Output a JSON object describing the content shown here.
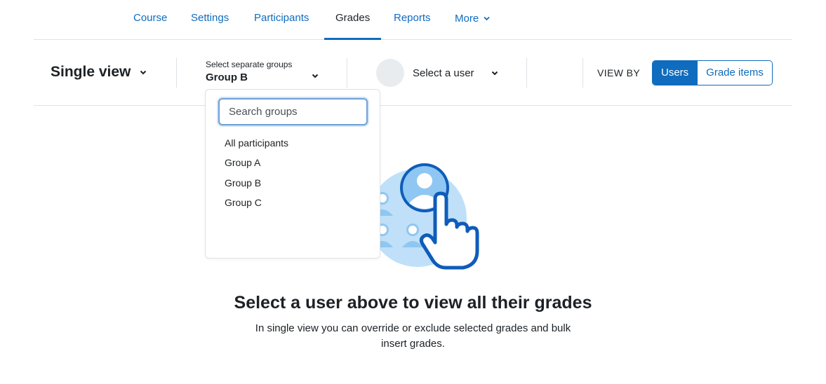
{
  "nav": {
    "tabs": [
      {
        "label": "Course"
      },
      {
        "label": "Settings"
      },
      {
        "label": "Participants"
      },
      {
        "label": "Grades"
      },
      {
        "label": "Reports"
      },
      {
        "label": "More"
      }
    ],
    "active_tab": "Grades"
  },
  "tertiary": {
    "view_selector": "Single view",
    "group_select": {
      "label": "Select separate groups",
      "value": "Group B"
    },
    "user_select": "Select a user",
    "view_by": "VIEW BY",
    "view_buttons": [
      {
        "label": "Users",
        "active": true
      },
      {
        "label": "Grade items",
        "active": false
      }
    ]
  },
  "group_dropdown": {
    "search_placeholder": "Search groups",
    "search_value": "",
    "options": [
      "All participants",
      "Group A",
      "Group B",
      "Group C"
    ]
  },
  "empty_state": {
    "title": "Select a user above to view all their grades",
    "description": "In single view you can override or exclude selected grades and bulk insert grades."
  },
  "colors": {
    "accent": "#0f6cbf",
    "text": "#1d2125",
    "border": "#dee2e6",
    "avatar_bg": "#e9ecef",
    "illustration_light": "#bfe0f8",
    "illustration_mid": "#8fc7f2",
    "illustration_dark": "#0f5cba"
  }
}
